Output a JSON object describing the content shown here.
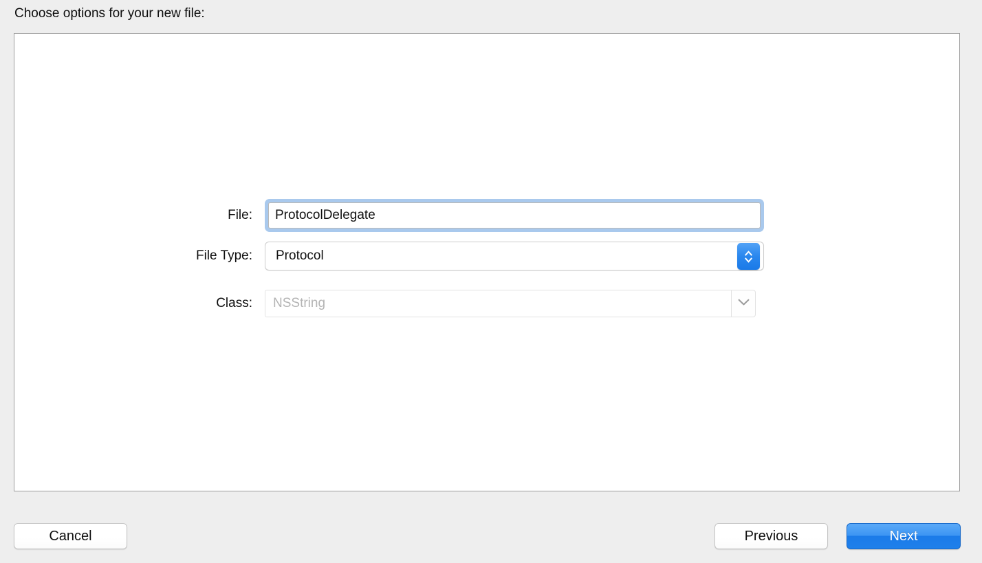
{
  "dialog": {
    "prompt": "Choose options for your new file:"
  },
  "form": {
    "file": {
      "label": "File:",
      "value": "ProtocolDelegate",
      "placeholder": ""
    },
    "file_type": {
      "label": "File Type:",
      "value": "Protocol",
      "stepper_icon": "chevron-up-down-icon"
    },
    "class": {
      "label": "Class:",
      "value": "",
      "placeholder": "NSString",
      "arrow_icon": "chevron-down-icon"
    }
  },
  "footer": {
    "cancel_label": "Cancel",
    "previous_label": "Previous",
    "next_label": "Next"
  },
  "colors": {
    "accent_blue": "#2a87ee",
    "default_button_blue": "#3c95f3",
    "focus_ring": "#a9c9ed",
    "window_background": "#eeeeee",
    "panel_background": "#ffffff",
    "panel_border": "#9b9b9b",
    "placeholder_text": "#b4b4b4"
  }
}
